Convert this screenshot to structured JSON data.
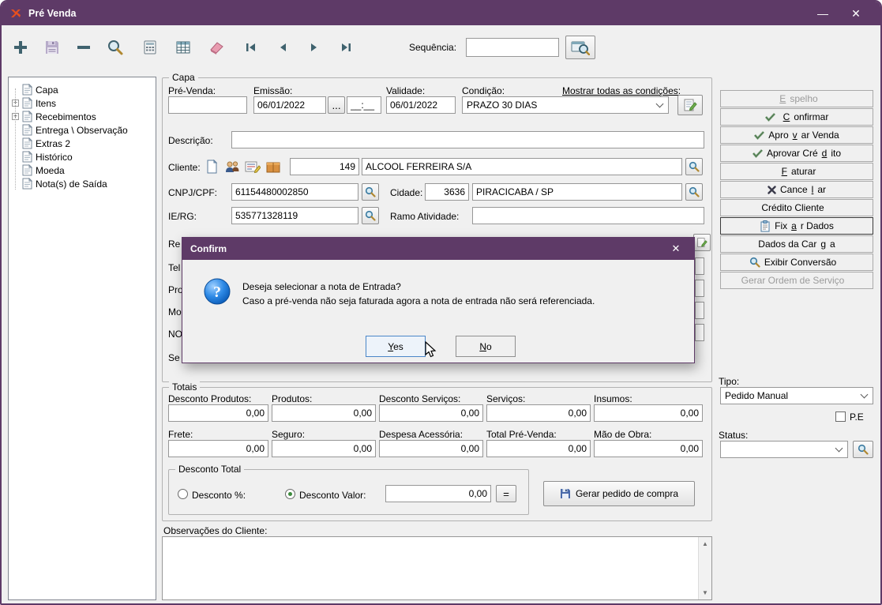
{
  "window": {
    "title": "Pré Venda",
    "minimize_glyph": "—",
    "close_glyph": "✕"
  },
  "toolbar": {
    "sequence_label": "Sequência:",
    "sequence_value": "",
    "icon_names": [
      "add-icon",
      "save-icon",
      "remove-icon",
      "search-icon",
      "calculator-icon",
      "grid-icon",
      "eraser-icon",
      "nav-first-icon",
      "nav-prev-icon",
      "nav-next-icon",
      "nav-last-icon",
      "search-window-icon"
    ]
  },
  "tree": {
    "items": [
      {
        "label": "Capa",
        "expander": ""
      },
      {
        "label": "Itens",
        "expander": "+"
      },
      {
        "label": "Recebimentos",
        "expander": "+"
      },
      {
        "label": "Entrega \\ Observação",
        "expander": ""
      },
      {
        "label": "Extras 2",
        "expander": ""
      },
      {
        "label": "Histórico",
        "expander": ""
      },
      {
        "label": "Moeda",
        "expander": ""
      },
      {
        "label": "Nota(s) de Saída",
        "expander": ""
      }
    ]
  },
  "capa": {
    "legend": "Capa",
    "pre_venda_label": "Pré-Venda:",
    "pre_venda_value": "",
    "emissao_label": "Emissão:",
    "emissao_value": "06/01/2022",
    "emissao_picker": "...",
    "emissao_time": "__:__",
    "validade_label": "Validade:",
    "validade_value": "06/01/2022",
    "condicao_label": "Condição:",
    "condicao_value": "PRAZO 30 DIAS",
    "mostrar_link": "Mostrar todas as condições:",
    "descricao_label": "Descrição:",
    "descricao_value": "",
    "cliente_label": "Cliente:",
    "cliente_code": "149",
    "cliente_name": "ALCOOL FERREIRA S/A",
    "cnpj_label": "CNPJ/CPF:",
    "cnpj_value": "61154480002850",
    "cidade_label": "Cidade:",
    "cidade_code": "3636",
    "cidade_name": "PIRACICABA / SP",
    "ie_label": "IE/RG:",
    "ie_value": "535771328119",
    "ramo_label": "Ramo Atividade:",
    "ramo_value": "",
    "partial_labels": [
      "Re",
      "Tel",
      "Pro",
      "Mo",
      "NO",
      "Se"
    ]
  },
  "dialog": {
    "title": "Confirm",
    "close_glyph": "✕",
    "message_line1": "Deseja selecionar a nota de Entrada?",
    "message_line2": "Caso a pré-venda não seja faturada agora a nota de entrada não será referenciada.",
    "buttons": {
      "yes": {
        "pre": "",
        "key": "Y",
        "post": "es"
      },
      "no": {
        "pre": "",
        "key": "N",
        "post": "o"
      }
    }
  },
  "totais": {
    "legend": "Totais",
    "row1": [
      {
        "label": "Desconto Produtos:",
        "value": "0,00"
      },
      {
        "label": "Produtos:",
        "value": "0,00"
      },
      {
        "label": "Desconto Serviços:",
        "value": "0,00"
      },
      {
        "label": "Serviços:",
        "value": "0,00"
      },
      {
        "label": "Insumos:",
        "value": "0,00"
      }
    ],
    "row2": [
      {
        "label": "Frete:",
        "value": "0,00"
      },
      {
        "label": "Seguro:",
        "value": "0,00"
      },
      {
        "label": "Despesa Acessória:",
        "value": "0,00"
      },
      {
        "label": "Total Pré-Venda:",
        "value": "0,00"
      },
      {
        "label": "Mão de Obra:",
        "value": "0,00"
      }
    ],
    "desconto_total": {
      "legend": "Desconto Total",
      "radio_percent_label": "Desconto %:",
      "radio_valor_label": "Desconto Valor:",
      "selected": "valor",
      "valor": "0,00",
      "equals_label": "="
    },
    "gerar_pedido_label": "Gerar pedido de compra"
  },
  "observacoes": {
    "label": "Observações do Cliente:",
    "value": ""
  },
  "panel": {
    "buttons": [
      {
        "pre": "",
        "key": "E",
        "post": "spelho",
        "icon": "",
        "disabled": true
      },
      {
        "pre": "",
        "key": "C",
        "post": "onfirmar",
        "icon": "check-icon",
        "disabled": false
      },
      {
        "pre": "Apro",
        "key": "v",
        "post": "ar Venda",
        "icon": "check-icon",
        "disabled": false
      },
      {
        "pre": "Aprovar Cré",
        "key": "d",
        "post": "ito",
        "icon": "check-icon",
        "disabled": false
      },
      {
        "pre": "",
        "key": "F",
        "post": "aturar",
        "icon": "",
        "disabled": false
      },
      {
        "pre": "Cance",
        "key": "l",
        "post": "ar",
        "icon": "cancel-x-icon",
        "disabled": false
      },
      {
        "pre": "Crédito Cliente",
        "key": "",
        "post": "",
        "icon": "",
        "disabled": false
      },
      {
        "pre": "Fix",
        "key": "a",
        "post": "r Dados",
        "icon": "clipboard-icon",
        "disabled": false
      },
      {
        "pre": "Dados da Car",
        "key": "g",
        "post": "a",
        "icon": "",
        "disabled": false
      },
      {
        "pre": "Exibir Conversão",
        "key": "",
        "post": "",
        "icon": "search-icon",
        "disabled": false
      },
      {
        "pre": "Gerar Ordem de Serviço",
        "key": "",
        "post": "",
        "icon": "",
        "disabled": true
      }
    ],
    "tipo_label": "Tipo:",
    "tipo_value": "Pedido Manual",
    "pe_label": "P.E",
    "status_label": "Status:",
    "status_value": ""
  },
  "colors": {
    "titlebar_purple": "#5e3a67",
    "toolbar_icon_teal": "#3f626e",
    "check_green": "#4d7a4d",
    "question_blue": "#2e8ae6",
    "background": "#f0f0f0"
  }
}
